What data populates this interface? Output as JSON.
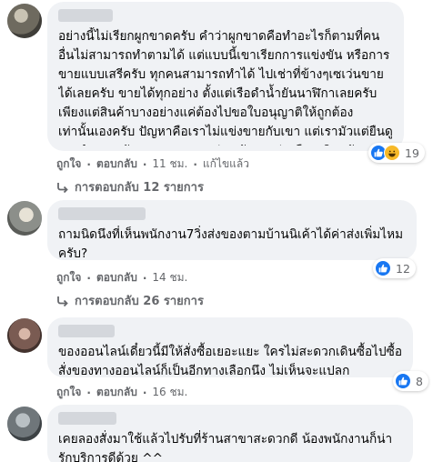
{
  "comments": [
    {
      "text": "อย่างนี้ไม่เรียกผูกขาดครับ คำว่าผูกขาดคือทำอะไรก็ตามที่คนอื่นไม่สามารถทำตามได้ แต่แบบนี้เขาเรียกการแข่งขัน หรือการขายแบบเสรีครับ ทุกคนสามารถทำได้ ไปเช่าที่ข้างๆเซเว่นขายได้เลยครับ ขายได้ทุกอย่าง ตั้งแต่เรือดำน้ำยันนาฬิกาเลยครับ เพียงแต่สินค้าบางอย่างแค่ต้องไปขอใบอนุญาติให้ถูกต้อง เท่านั้นเองครับ ปัญหาคือเราไม่แข่งขายกับเขา แต่เรามัวแต่ยืนดูเขาทำงานครับ เขาเลยรวย แต่เรายังจนอยู่เหมือนเดิมครับ",
      "reaction_count": "19",
      "like": "ถูกใจ",
      "reply": "ตอบกลับ",
      "time": "11 ชม.",
      "edited": "แก้ไขแล้ว",
      "replies_label": "การตอบกลับ 12 รายการ"
    },
    {
      "text": "ถามนิดนึงที่เห็นพนักงาน7วิ่งส่งของตามบ้านนิเค้าได้ค่าส่งเพิ่มไหมครับ?",
      "reaction_count": "12",
      "like": "ถูกใจ",
      "reply": "ตอบกลับ",
      "time": "14 ชม.",
      "replies_label": "การตอบกลับ 26 รายการ"
    },
    {
      "text": "ของออนไลน์เดี๋ยวนี้มีให้สั่งซื้อเยอะแยะ ใครไม่สะดวกเดินซื้อไปซื้อ สั่งของทางออนไลน์ก็เป็นอีกทางเลือกนึง ไม่เห็นจะแปลก",
      "reaction_count": "8",
      "like": "ถูกใจ",
      "reply": "ตอบกลับ",
      "time": "16 ชม."
    },
    {
      "text": "เคยลองสั่งมาใช้แล้วไปรับที่ร้านสาขาสะดวกดี น้องพนักงานก็น่ารักบริการดีด้วย ^^"
    }
  ],
  "colors": {
    "like": "#1877f2",
    "haha": "#f7b928",
    "bubble": "#f0f2f5",
    "meta": "#65676b"
  }
}
